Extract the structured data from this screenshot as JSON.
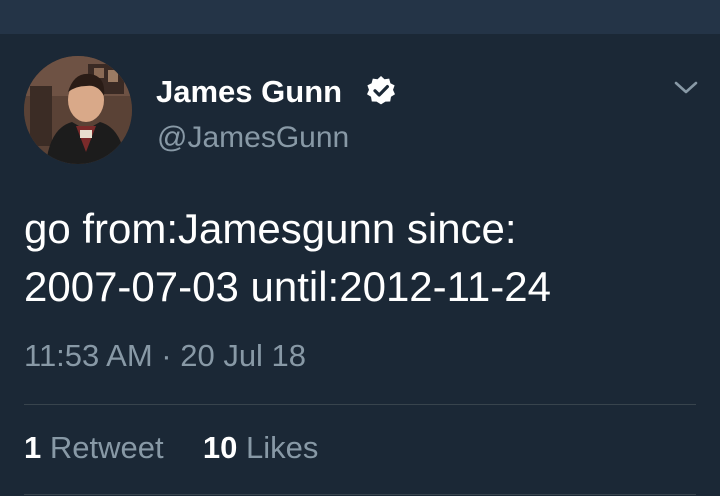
{
  "tweet": {
    "author": {
      "display_name": "James Gunn",
      "handle": "@JamesGunn",
      "verified": true
    },
    "text_lines": [
      "go from:Jamesgunn since:",
      "2007-07-03 until:2012-11-24"
    ],
    "timestamp": "11:53 AM · 20 Jul 18",
    "stats": {
      "retweets_count": "1",
      "retweets_label": "Retweet",
      "likes_count": "10",
      "likes_label": "Likes"
    }
  },
  "colors": {
    "background": "#1b2836",
    "top_bar": "#243447",
    "primary_text": "#ffffff",
    "secondary_text": "#8899a6",
    "divider": "#38444d"
  },
  "icons": [
    "verified-icon",
    "chevron-down-icon"
  ]
}
